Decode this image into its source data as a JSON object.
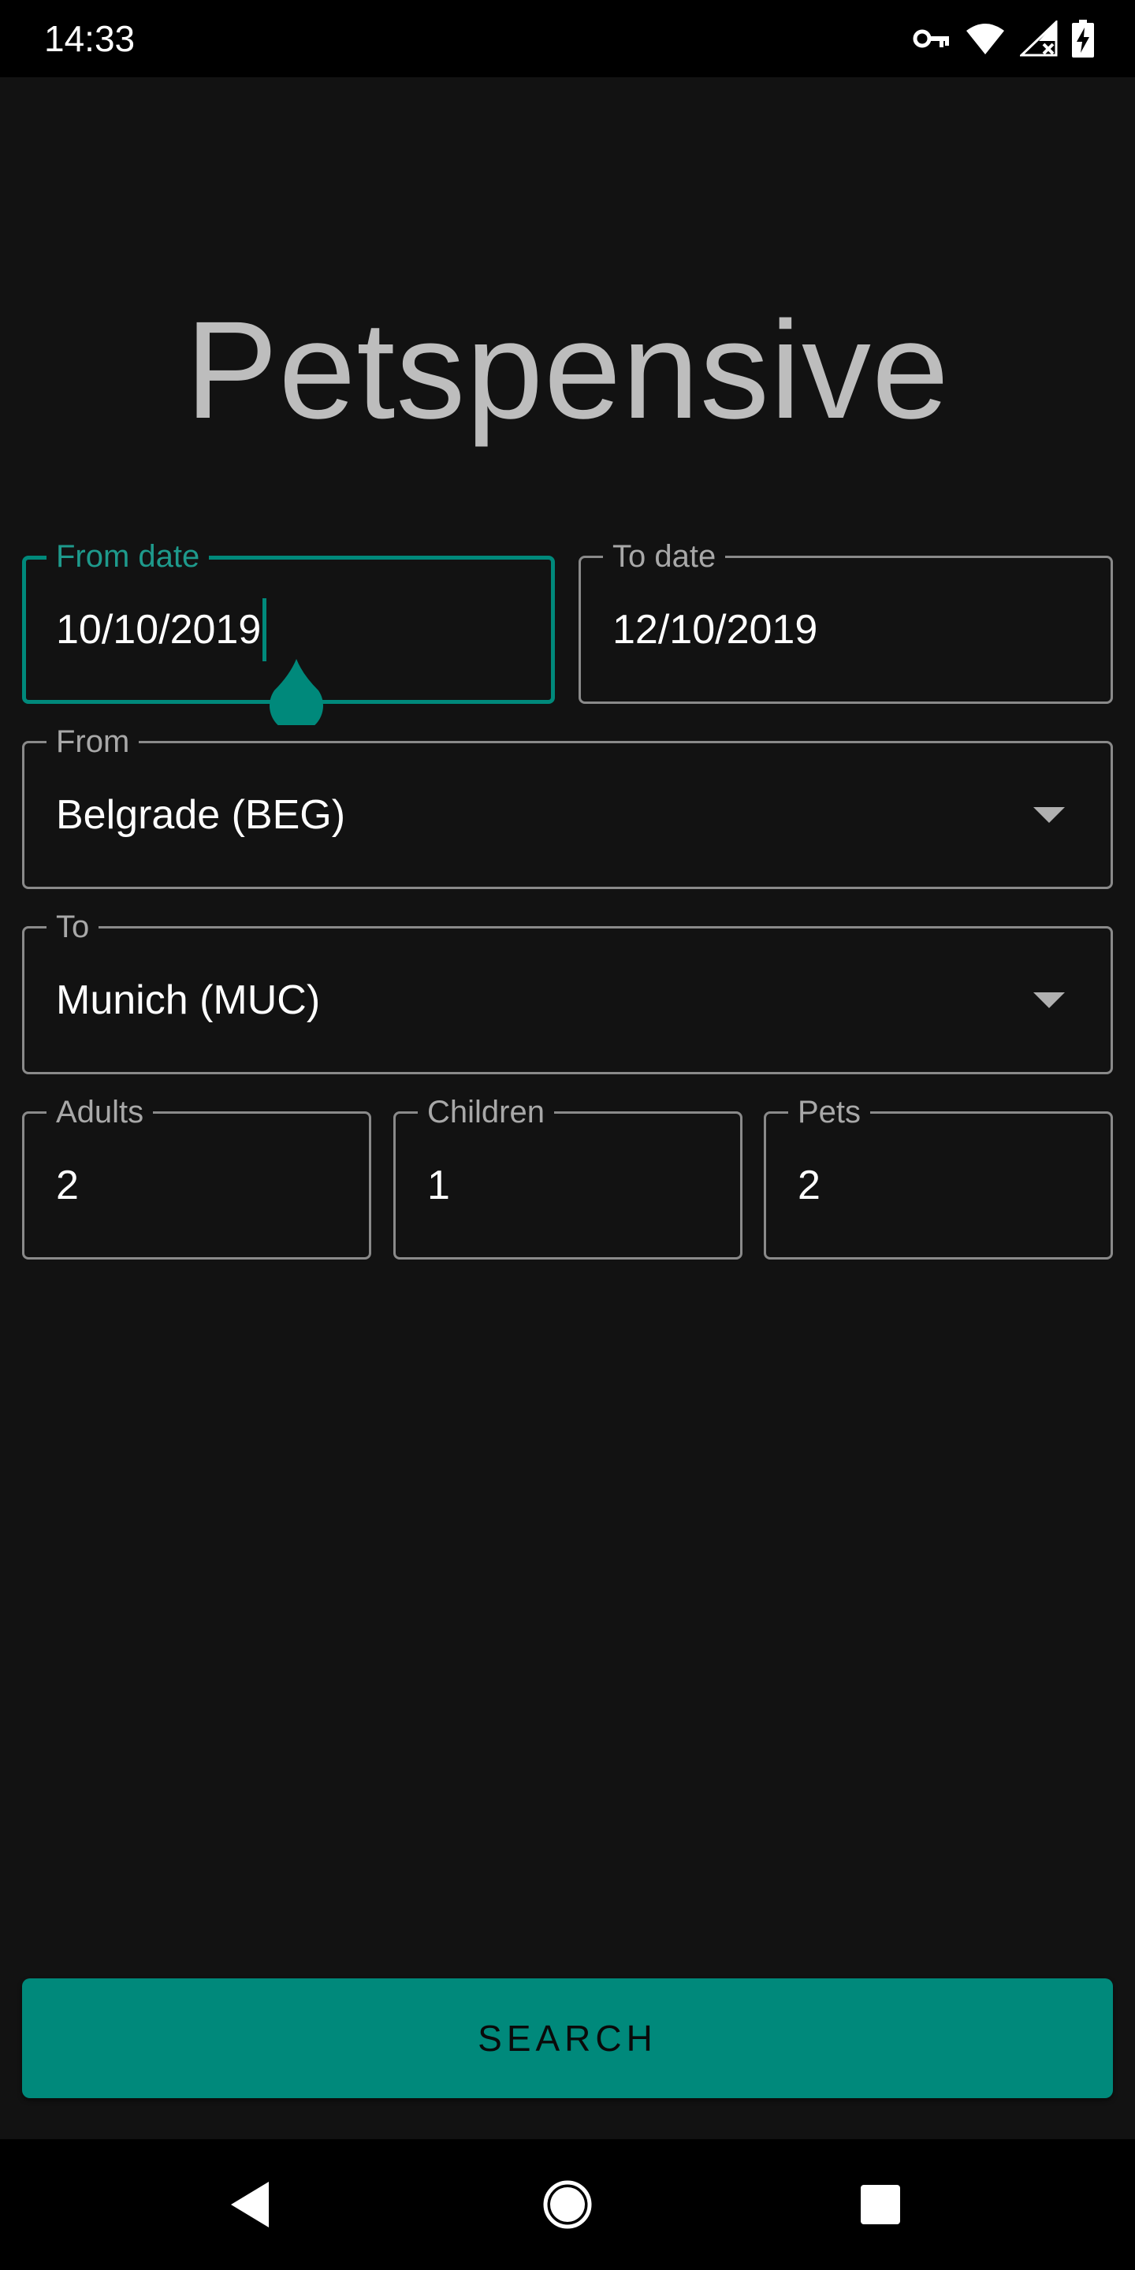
{
  "status_bar": {
    "time": "14:33",
    "icons": [
      "vpn-key-icon",
      "wifi-icon",
      "cellular-no-signal-icon",
      "battery-charging-icon"
    ]
  },
  "app": {
    "title": "Petspensive"
  },
  "form": {
    "from_date": {
      "label": "From date",
      "value": "10/10/2019",
      "focused": true
    },
    "to_date": {
      "label": "To date",
      "value": "12/10/2019"
    },
    "from": {
      "label": "From",
      "value": "Belgrade (BEG)"
    },
    "to": {
      "label": "To",
      "value": "Munich (MUC)"
    },
    "adults": {
      "label": "Adults",
      "value": "2"
    },
    "children": {
      "label": "Children",
      "value": "1"
    },
    "pets": {
      "label": "Pets",
      "value": "2"
    }
  },
  "actions": {
    "search_label": "SEARCH"
  },
  "nav_bar": {
    "icons": [
      "back-icon",
      "home-icon",
      "recents-icon"
    ]
  },
  "colors": {
    "accent": "#00897b",
    "background": "#121212",
    "outline": "#8a8a8a",
    "title": "#bdbdbd"
  }
}
